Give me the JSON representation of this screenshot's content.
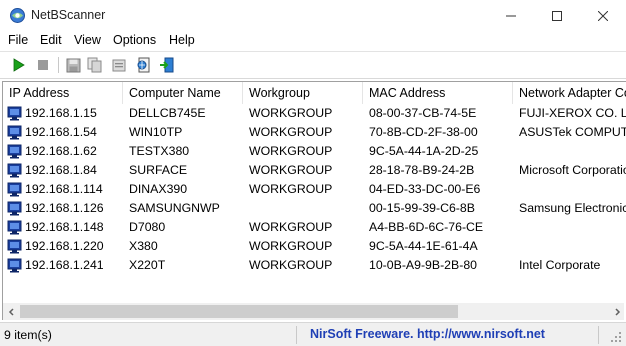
{
  "window": {
    "title": "NetBScanner",
    "icons": {
      "app": "netbscanner-app-icon",
      "minimize": "minimize-icon",
      "maximize": "maximize-icon",
      "close": "close-icon"
    }
  },
  "menu": [
    "File",
    "Edit",
    "View",
    "Options",
    "Help"
  ],
  "toolbar": {
    "buttons": [
      "start-icon",
      "stop-icon",
      "save-icon",
      "copy-icon",
      "properties-icon",
      "html-report-icon",
      "exit-icon"
    ]
  },
  "table": {
    "columns": [
      "IP Address",
      "Computer Name",
      "Workgroup",
      "MAC Address",
      "Network Adapter Company"
    ],
    "rows": [
      [
        "192.168.1.15",
        "DELLCB745E",
        "WORKGROUP",
        "08-00-37-CB-74-5E",
        "FUJI-XEROX CO. LTD."
      ],
      [
        "192.168.1.54",
        "WIN10TP",
        "WORKGROUP",
        "70-8B-CD-2F-38-00",
        "ASUSTek COMPUTER INC."
      ],
      [
        "192.168.1.62",
        "TESTX380",
        "WORKGROUP",
        "9C-5A-44-1A-2D-25",
        ""
      ],
      [
        "192.168.1.84",
        "SURFACE",
        "WORKGROUP",
        "28-18-78-B9-24-2B",
        "Microsoft Corporation"
      ],
      [
        "192.168.1.114",
        "DINAX390",
        "WORKGROUP",
        "04-ED-33-DC-00-E6",
        ""
      ],
      [
        "192.168.1.126",
        "SAMSUNGNWP",
        "",
        "00-15-99-39-C6-8B",
        "Samsung Electronics Co.,Ltd"
      ],
      [
        "192.168.1.148",
        "D7080",
        "WORKGROUP",
        "A4-BB-6D-6C-76-CE",
        ""
      ],
      [
        "192.168.1.220",
        "X380",
        "WORKGROUP",
        "9C-5A-44-1E-61-4A",
        ""
      ],
      [
        "192.168.1.241",
        "X220T",
        "WORKGROUP",
        "10-0B-A9-9B-2B-80",
        "Intel Corporate"
      ]
    ]
  },
  "status": {
    "items": "9 item(s)",
    "link": "NirSoft Freeware.  http://www.nirsoft.net"
  },
  "colors": {
    "link": "#1f3fb5",
    "start": "#1aa11a",
    "computer_icon": "#1a3f9e"
  }
}
